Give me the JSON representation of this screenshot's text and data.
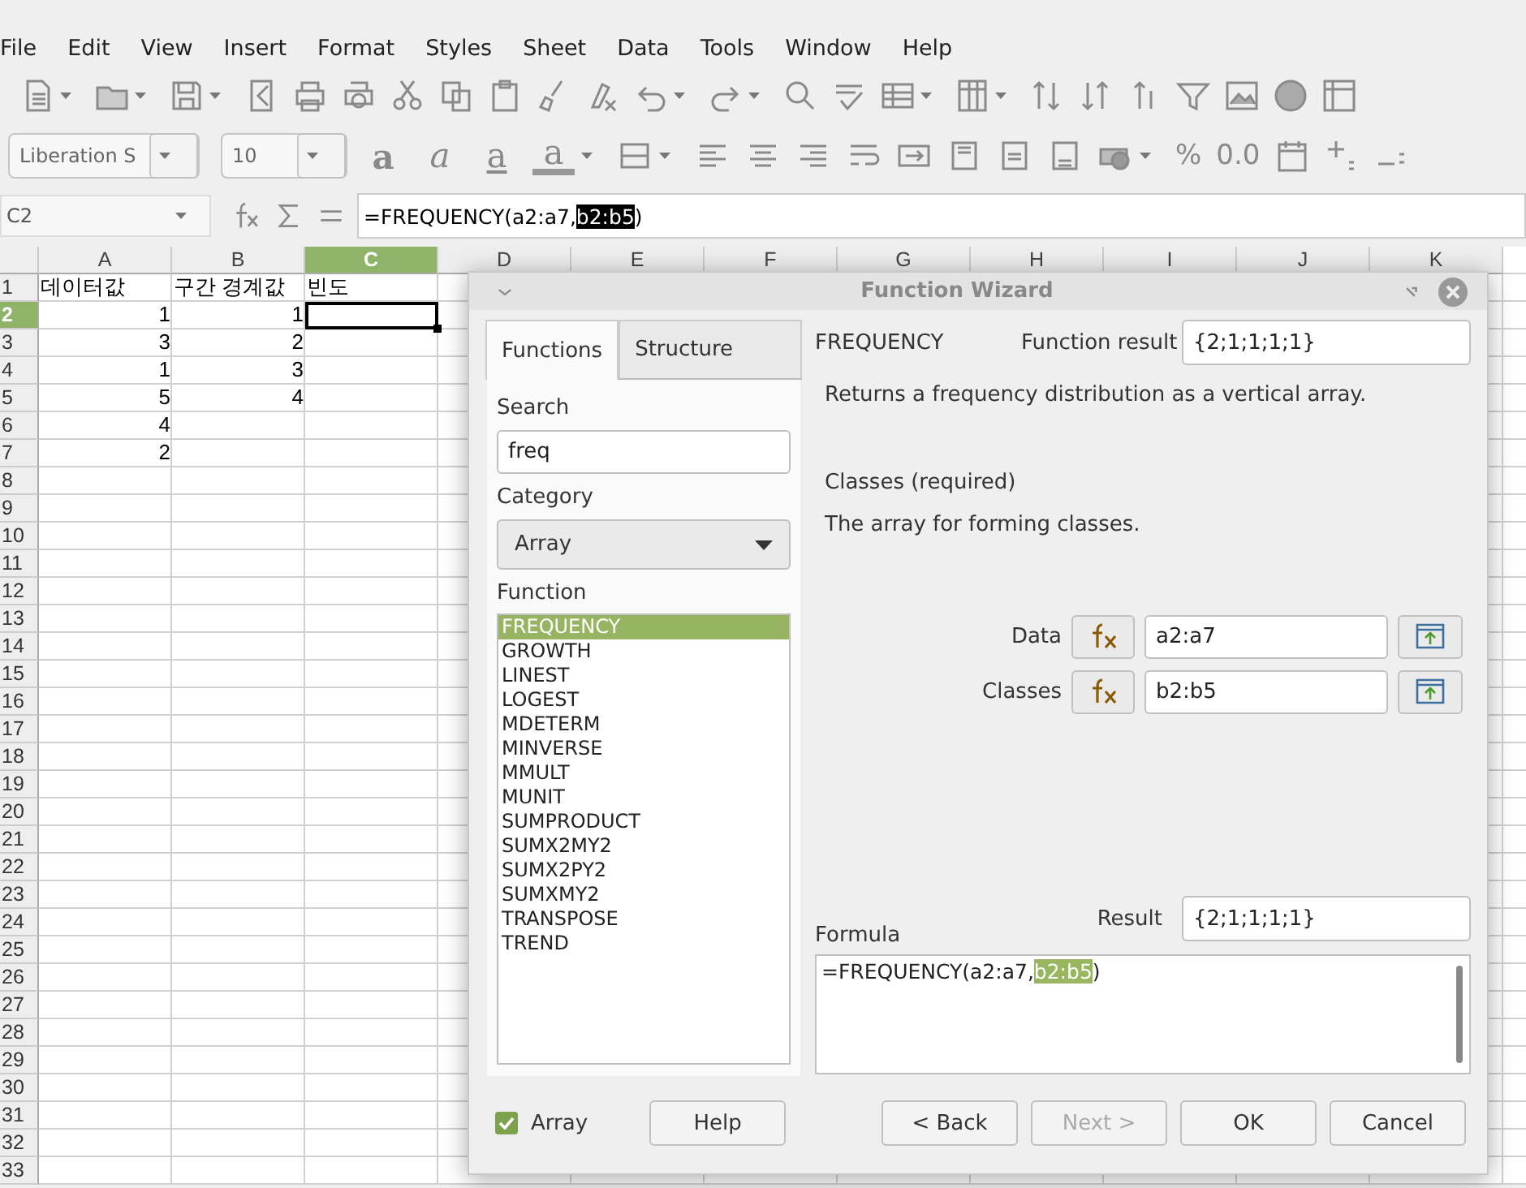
{
  "menu": [
    {
      "label": "File"
    },
    {
      "label": "Edit"
    },
    {
      "label": "View"
    },
    {
      "label": "Insert"
    },
    {
      "label": "Format"
    },
    {
      "label": "Styles"
    },
    {
      "label": "Sheet"
    },
    {
      "label": "Data"
    },
    {
      "label": "Tools"
    },
    {
      "label": "Window"
    },
    {
      "label": "Help"
    }
  ],
  "format_toolbar": {
    "font_name": "Liberation S",
    "font_size": "10",
    "glyphs": [
      {
        "text": "a",
        "kind": "bold"
      },
      {
        "text": "a",
        "kind": "italic"
      },
      {
        "text": "a",
        "kind": "underline"
      },
      {
        "text": "a",
        "kind": "font-color"
      }
    ],
    "number_glyphs": [
      {
        "text": "%"
      },
      {
        "text": "0.0"
      }
    ]
  },
  "formula_bar": {
    "cell_ref": "C2",
    "segments": [
      {
        "text": "=FREQUENCY(a2:a7,",
        "highlighted": false
      },
      {
        "text": "b2:b5",
        "highlighted": true
      },
      {
        "text": ")",
        "highlighted": false
      }
    ]
  },
  "sheet": {
    "columns": [
      {
        "label": "A",
        "selected": false
      },
      {
        "label": "B",
        "selected": false
      },
      {
        "label": "C",
        "selected": true
      },
      {
        "label": "D",
        "selected": false
      },
      {
        "label": "E",
        "selected": false
      },
      {
        "label": "F",
        "selected": false
      },
      {
        "label": "G",
        "selected": false
      },
      {
        "label": "H",
        "selected": false
      },
      {
        "label": "I",
        "selected": false
      },
      {
        "label": "J",
        "selected": false
      },
      {
        "label": "K",
        "selected": false
      }
    ],
    "rows": [
      {
        "label": "1",
        "selected": false,
        "cells": [
          {
            "text": "데이터값",
            "kind": "text"
          },
          {
            "text": "구간 경계값",
            "kind": "text"
          },
          {
            "text": "빈도",
            "kind": "text"
          }
        ]
      },
      {
        "label": "2",
        "selected": true,
        "cells": [
          {
            "text": "1",
            "kind": "number"
          },
          {
            "text": "1",
            "kind": "number"
          },
          {
            "kind": "cursor"
          }
        ]
      },
      {
        "label": "3",
        "selected": false,
        "cells": [
          {
            "text": "3",
            "kind": "number"
          },
          {
            "text": "2",
            "kind": "number"
          }
        ]
      },
      {
        "label": "4",
        "selected": false,
        "cells": [
          {
            "text": "1",
            "kind": "number"
          },
          {
            "text": "3",
            "kind": "number"
          }
        ]
      },
      {
        "label": "5",
        "selected": false,
        "cells": [
          {
            "text": "5",
            "kind": "number"
          },
          {
            "text": "4",
            "kind": "number"
          }
        ]
      },
      {
        "label": "6",
        "selected": false,
        "cells": [
          {
            "text": "4",
            "kind": "number"
          }
        ]
      },
      {
        "label": "7",
        "selected": false,
        "cells": [
          {
            "text": "2",
            "kind": "number"
          }
        ]
      },
      {
        "label": "8",
        "selected": false
      },
      {
        "label": "9",
        "selected": false
      },
      {
        "label": "10",
        "selected": false
      },
      {
        "label": "11",
        "selected": false
      },
      {
        "label": "12",
        "selected": false
      },
      {
        "label": "13",
        "selected": false
      },
      {
        "label": "14",
        "selected": false
      },
      {
        "label": "15",
        "selected": false
      },
      {
        "label": "16",
        "selected": false
      },
      {
        "label": "17",
        "selected": false
      },
      {
        "label": "18",
        "selected": false
      },
      {
        "label": "19",
        "selected": false
      },
      {
        "label": "20",
        "selected": false
      },
      {
        "label": "21",
        "selected": false
      },
      {
        "label": "22",
        "selected": false
      },
      {
        "label": "23",
        "selected": false
      },
      {
        "label": "24",
        "selected": false
      },
      {
        "label": "25",
        "selected": false
      },
      {
        "label": "26",
        "selected": false
      },
      {
        "label": "27",
        "selected": false
      },
      {
        "label": "28",
        "selected": false
      },
      {
        "label": "29",
        "selected": false
      },
      {
        "label": "30",
        "selected": false
      },
      {
        "label": "31",
        "selected": false
      },
      {
        "label": "32",
        "selected": false
      },
      {
        "label": "33",
        "selected": false
      }
    ]
  },
  "dialog": {
    "title": "Function Wizard",
    "tabs": [
      {
        "label": "Functions",
        "selected": true
      },
      {
        "label": "Structure",
        "selected": false
      }
    ],
    "search_label": "Search",
    "search_value": "freq",
    "category_label": "Category",
    "category_value": "Array",
    "function_label": "Function",
    "functions": [
      {
        "name": "FREQUENCY",
        "selected": true
      },
      {
        "name": "GROWTH",
        "selected": false
      },
      {
        "name": "LINEST",
        "selected": false
      },
      {
        "name": "LOGEST",
        "selected": false
      },
      {
        "name": "MDETERM",
        "selected": false
      },
      {
        "name": "MINVERSE",
        "selected": false
      },
      {
        "name": "MMULT",
        "selected": false
      },
      {
        "name": "MUNIT",
        "selected": false
      },
      {
        "name": "SUMPRODUCT",
        "selected": false
      },
      {
        "name": "SUMX2MY2",
        "selected": false
      },
      {
        "name": "SUMX2PY2",
        "selected": false
      },
      {
        "name": "SUMXMY2",
        "selected": false
      },
      {
        "name": "TRANSPOSE",
        "selected": false
      },
      {
        "name": "TREND",
        "selected": false
      }
    ],
    "function_name": "FREQUENCY",
    "function_result_label": "Function result",
    "function_result": "{2;1;1;1;1}",
    "description": "Returns a frequency distribution as a vertical array.",
    "argument_title": "Classes (required)",
    "argument_description": "The array for forming classes.",
    "arguments": [
      {
        "label": "Data",
        "value": "a2:a7"
      },
      {
        "label": "Classes",
        "value": "b2:b5"
      }
    ],
    "result_label": "Result",
    "result": "{2;1;1;1;1}",
    "formula_label": "Formula",
    "formula": [
      {
        "text": "=FREQUENCY(a2:a7,",
        "highlighted": false
      },
      {
        "text": "b2:b5",
        "highlighted": true
      },
      {
        "text": ")",
        "highlighted": false
      }
    ],
    "array": {
      "label": "Array",
      "checked": true
    },
    "buttons": [
      {
        "label": "Help",
        "disabled": false,
        "kind": "left"
      },
      {
        "label": "< Back",
        "disabled": false,
        "kind": "right"
      },
      {
        "label": "Next >",
        "disabled": true,
        "kind": "right"
      },
      {
        "label": "OK",
        "disabled": false,
        "kind": "right"
      },
      {
        "label": "Cancel",
        "disabled": false,
        "kind": "right"
      }
    ]
  }
}
